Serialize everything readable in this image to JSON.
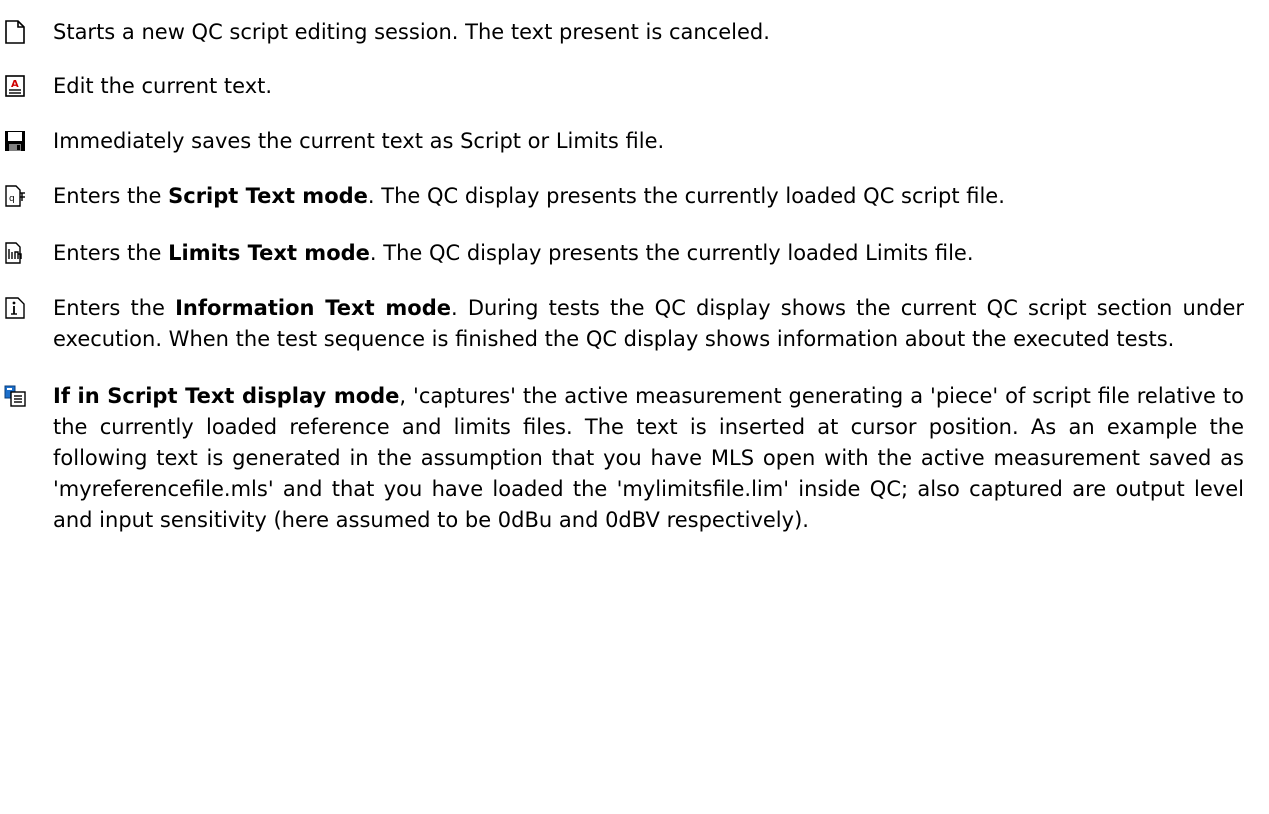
{
  "items": [
    {
      "icon": "new-document-icon",
      "segments": [
        {
          "text": "Starts a new QC script editing session. The text present is canceled.",
          "bold": false
        }
      ]
    },
    {
      "icon": "edit-text-icon",
      "segments": [
        {
          "text": "Edit the current text.",
          "bold": false
        }
      ]
    },
    {
      "icon": "save-floppy-icon",
      "segments": [
        {
          "text": "Immediately saves the current text as Script or Limits file.",
          "bold": false
        }
      ]
    },
    {
      "icon": "script-text-mode-icon",
      "segments": [
        {
          "text": "Enters the ",
          "bold": false
        },
        {
          "text": "Script Text mode",
          "bold": true
        },
        {
          "text": ". The QC display presents the currently loaded QC script file.",
          "bold": false
        }
      ]
    },
    {
      "icon": "limits-text-mode-icon",
      "segments": [
        {
          "text": "Enters the ",
          "bold": false
        },
        {
          "text": "Limits Text mode",
          "bold": true
        },
        {
          "text": ". The QC display presents the currently loaded Limits file.",
          "bold": false
        }
      ]
    },
    {
      "icon": "information-text-mode-icon",
      "segments": [
        {
          "text": "Enters the ",
          "bold": false
        },
        {
          "text": "Information Text mode",
          "bold": true
        },
        {
          "text": ". During tests the QC display shows the current QC script section under execution. When the test sequence is finished the QC display shows information about the executed tests.",
          "bold": false
        }
      ]
    },
    {
      "icon": "capture-measurement-icon",
      "segments": [
        {
          "text": "If in Script Text display mode",
          "bold": true
        },
        {
          "text": ", 'captures' the active measurement generating a 'piece' of script file relative to the currently loaded reference and limits files. The text is inserted at cursor position. As an example the following text is generated  in the assumption that you have MLS open with the active measurement saved as 'myreferencefile.mls' and that you have loaded  the 'mylimitsfile.lim' inside QC; also captured are output level and input sensitivity (here assumed to be 0dBu and 0dBV respectively).",
          "bold": false
        }
      ]
    }
  ]
}
